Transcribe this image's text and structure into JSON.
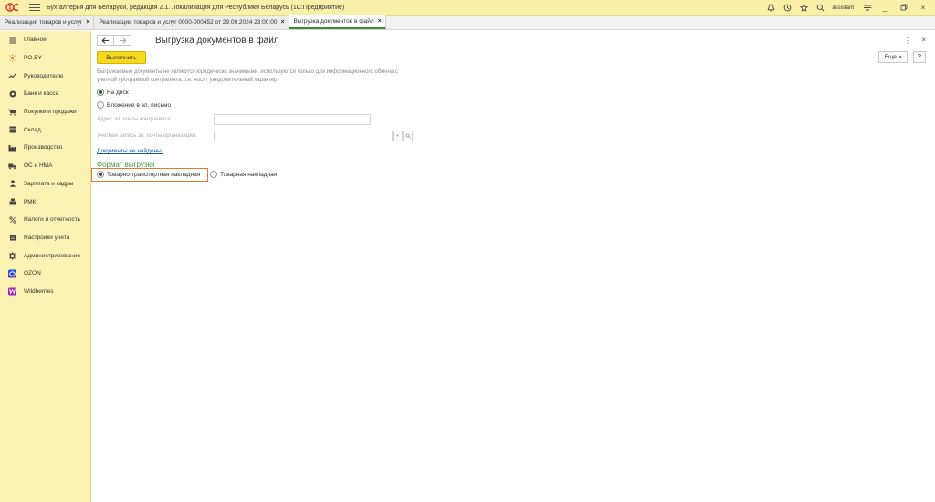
{
  "app": {
    "title": "Бухгалтерия для Беларуси, редакция 2.1. Локализация для Республики Беларусь   (1С:Предприятие)",
    "user": "assistant"
  },
  "tabs": [
    {
      "label": "Реализация товаров и услуг",
      "active": false
    },
    {
      "label": "Реализация товаров и услуг 0000-000452 от 29.09.2024 23:00:00",
      "active": false
    },
    {
      "label": "Выгрузка документов в файл",
      "active": true
    }
  ],
  "tab_close": "×",
  "sidebar": {
    "items": [
      {
        "label": "Главное",
        "icon": "menu-list-icon"
      },
      {
        "label": "PO.BY",
        "icon": "sun-icon"
      },
      {
        "label": "Руководителю",
        "icon": "trend-icon"
      },
      {
        "label": "Банк и касса",
        "icon": "coin-icon"
      },
      {
        "label": "Покупки и продажи",
        "icon": "cart-icon"
      },
      {
        "label": "Склад",
        "icon": "warehouse-icon"
      },
      {
        "label": "Производство",
        "icon": "factory-icon"
      },
      {
        "label": "ОС и НМА",
        "icon": "truck-icon"
      },
      {
        "label": "Зарплата и кадры",
        "icon": "person-icon"
      },
      {
        "label": "РМК",
        "icon": "register-icon"
      },
      {
        "label": "Налоги и отчетность",
        "icon": "percent-icon"
      },
      {
        "label": "Настройки учета",
        "icon": "book-icon"
      },
      {
        "label": "Администрирование",
        "icon": "gear-icon"
      },
      {
        "label": "OZON",
        "icon": "ozon-logo-icon"
      },
      {
        "label": "Wildberries",
        "icon": "wildberries-logo-icon"
      }
    ]
  },
  "form": {
    "title": "Выгрузка документов в файл",
    "menu_glyph": "⋮",
    "close_glyph": "×",
    "run_label": "Выполнить",
    "more_label": "Еще",
    "help_label": "?",
    "note": "Выгружаемые документы не являются юридически значимыми, используются только для информационного обмена с учетной программой контрагента, т.е. носят уведомительный характер.",
    "destination": {
      "options": [
        "На диск",
        "Вложение в эл. письмо"
      ],
      "selected": 0
    },
    "email_label": "Адрес эл. почты контрагента:",
    "email_value": "",
    "account_label": "Учетная запись эл. почты организации:",
    "account_value": "",
    "docs_link": "Документы не найдены.",
    "format_title": "Формат выгрузки",
    "format": {
      "options": [
        "Товарно-транспортная накладная",
        "Товарная накладная"
      ],
      "selected": 0
    }
  },
  "colors": {
    "sidebar_bg": "#fcf2b3",
    "titlebar_bg": "#fbf0a9",
    "run_button": "#f6d91c",
    "section_title": "#4b9a4b",
    "link": "#1a55a6",
    "highlight": "#e07b3c"
  }
}
